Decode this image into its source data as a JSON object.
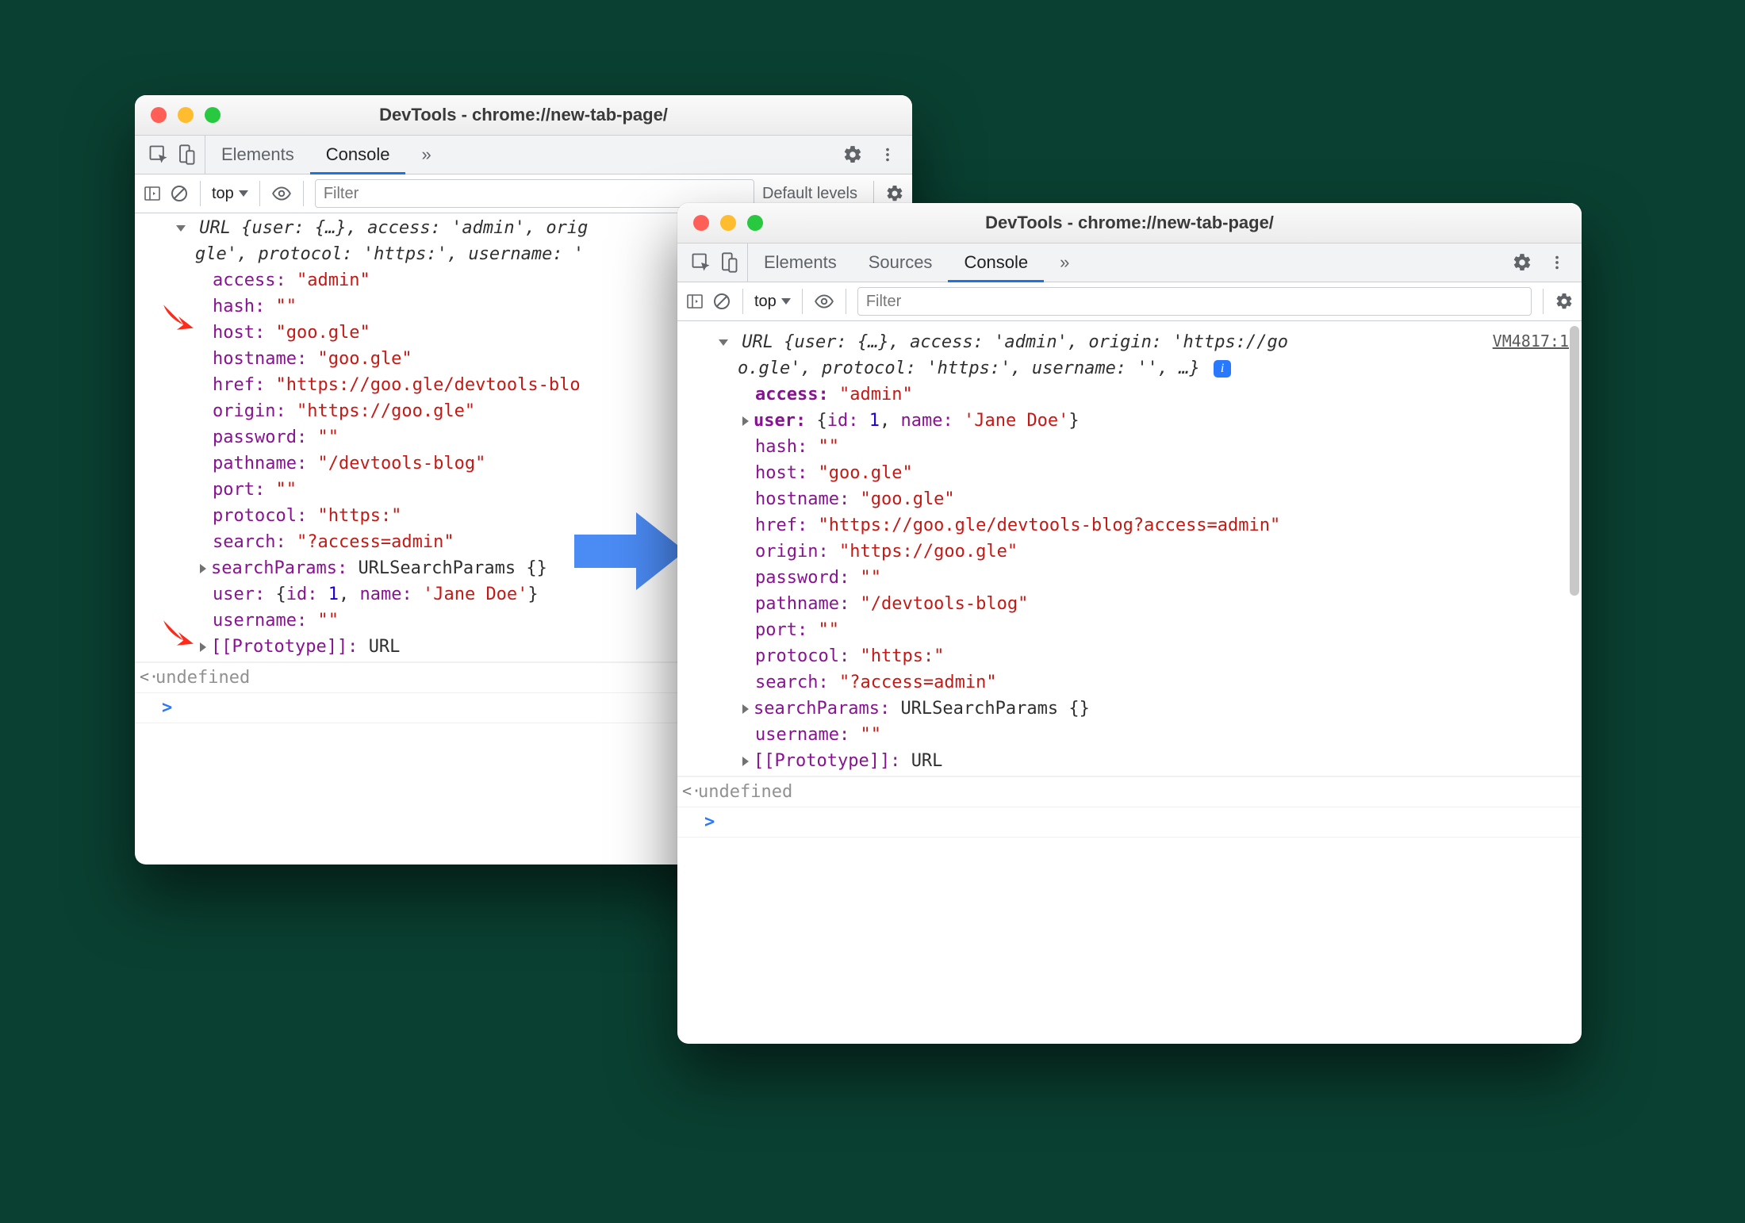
{
  "left": {
    "title": "DevTools - chrome://new-tab-page/",
    "tabs": {
      "elements": "Elements",
      "console": "Console"
    },
    "toolbar": {
      "context": "top",
      "filter_placeholder": "Filter",
      "levels": "Default levels"
    },
    "preview_line1": "URL {user: {…}, access: 'admin', orig",
    "preview_line2": "gle', protocol: 'https:', username: '",
    "props": {
      "access_k": "access:",
      "access_v": "\"admin\"",
      "hash_k": "hash:",
      "hash_v": "\"\"",
      "host_k": "host:",
      "host_v": "\"goo.gle\"",
      "hostname_k": "hostname:",
      "hostname_v": "\"goo.gle\"",
      "href_k": "href:",
      "href_v": "\"https://goo.gle/devtools-blo",
      "origin_k": "origin:",
      "origin_v": "\"https://goo.gle\"",
      "password_k": "password:",
      "password_v": "\"\"",
      "pathname_k": "pathname:",
      "pathname_v": "\"/devtools-blog\"",
      "port_k": "port:",
      "port_v": "\"\"",
      "protocol_k": "protocol:",
      "protocol_v": "\"https:\"",
      "search_k": "search:",
      "search_v": "\"?access=admin\"",
      "searchParams_k": "searchParams:",
      "searchParams_v": "URLSearchParams {}",
      "user_k": "user:",
      "user_pre": "{",
      "user_id_k": "id:",
      "user_id_v": "1",
      "user_comma": ", ",
      "user_name_k": "name:",
      "user_name_v": "'Jane Doe'",
      "user_post": "}",
      "username_k": "username:",
      "username_v": "\"\"",
      "proto_k": "[[Prototype]]:",
      "proto_v": "URL"
    },
    "undefined": "undefined"
  },
  "right": {
    "title": "DevTools - chrome://new-tab-page/",
    "tabs": {
      "elements": "Elements",
      "sources": "Sources",
      "console": "Console"
    },
    "toolbar": {
      "context": "top",
      "filter_placeholder": "Filter"
    },
    "source_link": "VM4817:1",
    "preview_line1": "URL {user: {…}, access: 'admin', origin: 'https://go",
    "preview_line2_a": "o.gle', protocol: 'https:', username: '', …}",
    "props": {
      "access_k": "access:",
      "access_v": "\"admin\"",
      "user_k": "user:",
      "user_pre": "{",
      "user_id_k": "id:",
      "user_id_v": "1",
      "user_comma": ", ",
      "user_name_k": "name:",
      "user_name_v": "'Jane Doe'",
      "user_post": "}",
      "hash_k": "hash:",
      "hash_v": "\"\"",
      "host_k": "host:",
      "host_v": "\"goo.gle\"",
      "hostname_k": "hostname:",
      "hostname_v": "\"goo.gle\"",
      "href_k": "href:",
      "href_v": "\"https://goo.gle/devtools-blog?access=admin\"",
      "origin_k": "origin:",
      "origin_v": "\"https://goo.gle\"",
      "password_k": "password:",
      "password_v": "\"\"",
      "pathname_k": "pathname:",
      "pathname_v": "\"/devtools-blog\"",
      "port_k": "port:",
      "port_v": "\"\"",
      "protocol_k": "protocol:",
      "protocol_v": "\"https:\"",
      "search_k": "search:",
      "search_v": "\"?access=admin\"",
      "searchParams_k": "searchParams:",
      "searchParams_v": "URLSearchParams {}",
      "username_k": "username:",
      "username_v": "\"\"",
      "proto_k": "[[Prototype]]:",
      "proto_v": "URL"
    },
    "undefined": "undefined"
  }
}
